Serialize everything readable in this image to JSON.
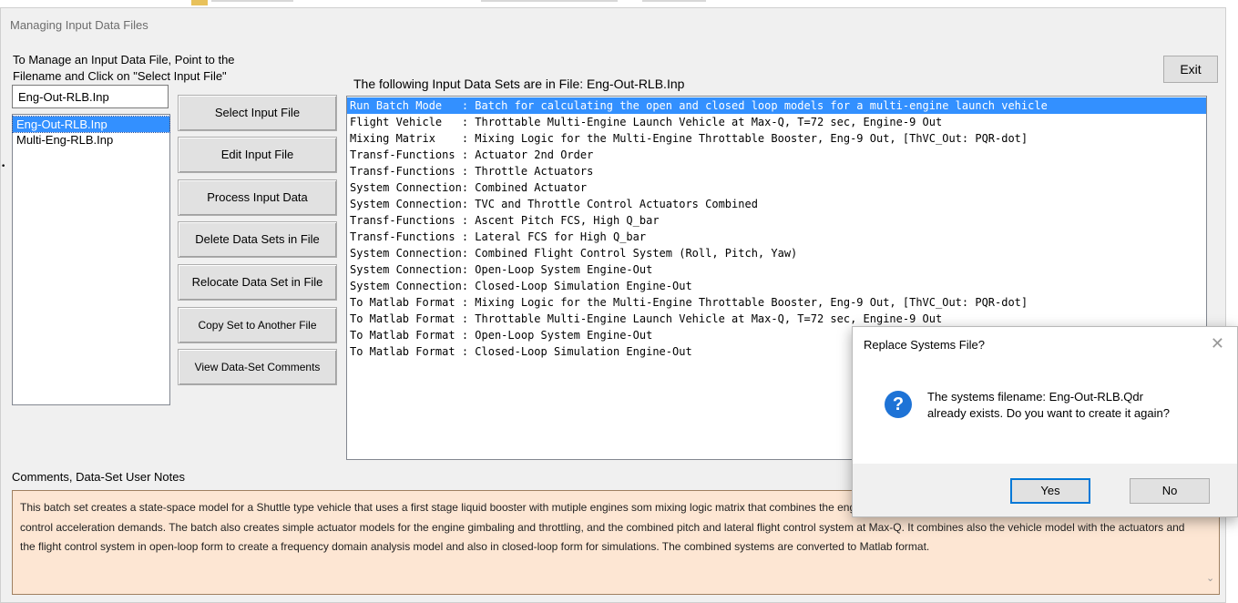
{
  "window": {
    "title": "Managing Input Data Files"
  },
  "instructions": {
    "line1": "To Manage an Input Data File, Point to the",
    "line2": "Filename and Click on \"Select Input File\""
  },
  "file_selector": {
    "current_value": "Eng-Out-RLB.Inp",
    "files": [
      "Eng-Out-RLB.Inp",
      "Multi-Eng-RLB.Inp"
    ],
    "selected_index": 0
  },
  "buttons": {
    "select": "Select Input File",
    "edit": "Edit Input File",
    "process": "Process Input Data",
    "delete": "Delete Data Sets in File",
    "relocate": "Relocate Data Set in File",
    "copy": "Copy Set to Another File",
    "view": "View Data-Set Comments",
    "exit": "Exit"
  },
  "datasets": {
    "header": "The following Input Data Sets are in File: Eng-Out-RLB.Inp",
    "selected_index": 0,
    "rows": [
      "Run Batch Mode   : Batch for calculating the open and closed loop models for a multi-engine launch vehicle",
      "Flight Vehicle   : Throttable Multi-Engine Launch Vehicle at Max-Q, T=72 sec, Engine-9 Out",
      "Mixing Matrix    : Mixing Logic for the Multi-Engine Throttable Booster, Eng-9 Out, [ThVC_Out: PQR-dot]",
      "Transf-Functions : Actuator 2nd Order",
      "Transf-Functions : Throttle Actuators",
      "System Connection: Combined Actuator",
      "System Connection: TVC and Throttle Control Actuators Combined",
      "Transf-Functions : Ascent Pitch FCS, High Q_bar",
      "Transf-Functions : Lateral FCS for High Q_bar",
      "System Connection: Combined Flight Control System (Roll, Pitch, Yaw)",
      "System Connection: Open-Loop System Engine-Out",
      "System Connection: Closed-Loop Simulation Engine-Out",
      "To Matlab Format : Mixing Logic for the Multi-Engine Throttable Booster, Eng-9 Out, [ThVC_Out: PQR-dot]",
      "To Matlab Format : Throttable Multi-Engine Launch Vehicle at Max-Q, T=72 sec, Engine-9 Out",
      "To Matlab Format : Open-Loop System Engine-Out",
      "To Matlab Format : Closed-Loop Simulation Engine-Out"
    ]
  },
  "notes": {
    "label": "Comments, Data-Set User Notes",
    "text": "This batch set creates a state-space model for a Shuttle type vehicle that uses a first  stage liquid booster with mutiple engines som mixing logic matrix that combines the engine gimbaling and throttling in  response to roll, pitch and yaw flight control acceleration demands. The batch also creates  simple actuator models for the engine gimbaling and throttling, and the combined pitch and  lateral flight control system at Max-Q. It combines also the vehicle model with the actuators  and the flight control system in open-loop form to create a frequency domain analysis model and  also in closed-loop form for simulations. The combined systems are converted to Matlab format."
  },
  "dialog": {
    "title": "Replace Systems File?",
    "close_glyph": "✕",
    "icon_glyph": "?",
    "message_line1": "The systems filename: Eng-Out-RLB.Qdr",
    "message_line2": "already exists. Do you want to create it again?",
    "yes": "Yes",
    "no": "No"
  },
  "icons": {
    "dialog_icon": "question-icon",
    "notes_scroll": "chevron-down-icon"
  },
  "colors": {
    "selection": "#3390ff",
    "notes_bg": "#fde6d3",
    "dialog_icon": "#1e73d6",
    "default_button_border": "#0078d7"
  }
}
